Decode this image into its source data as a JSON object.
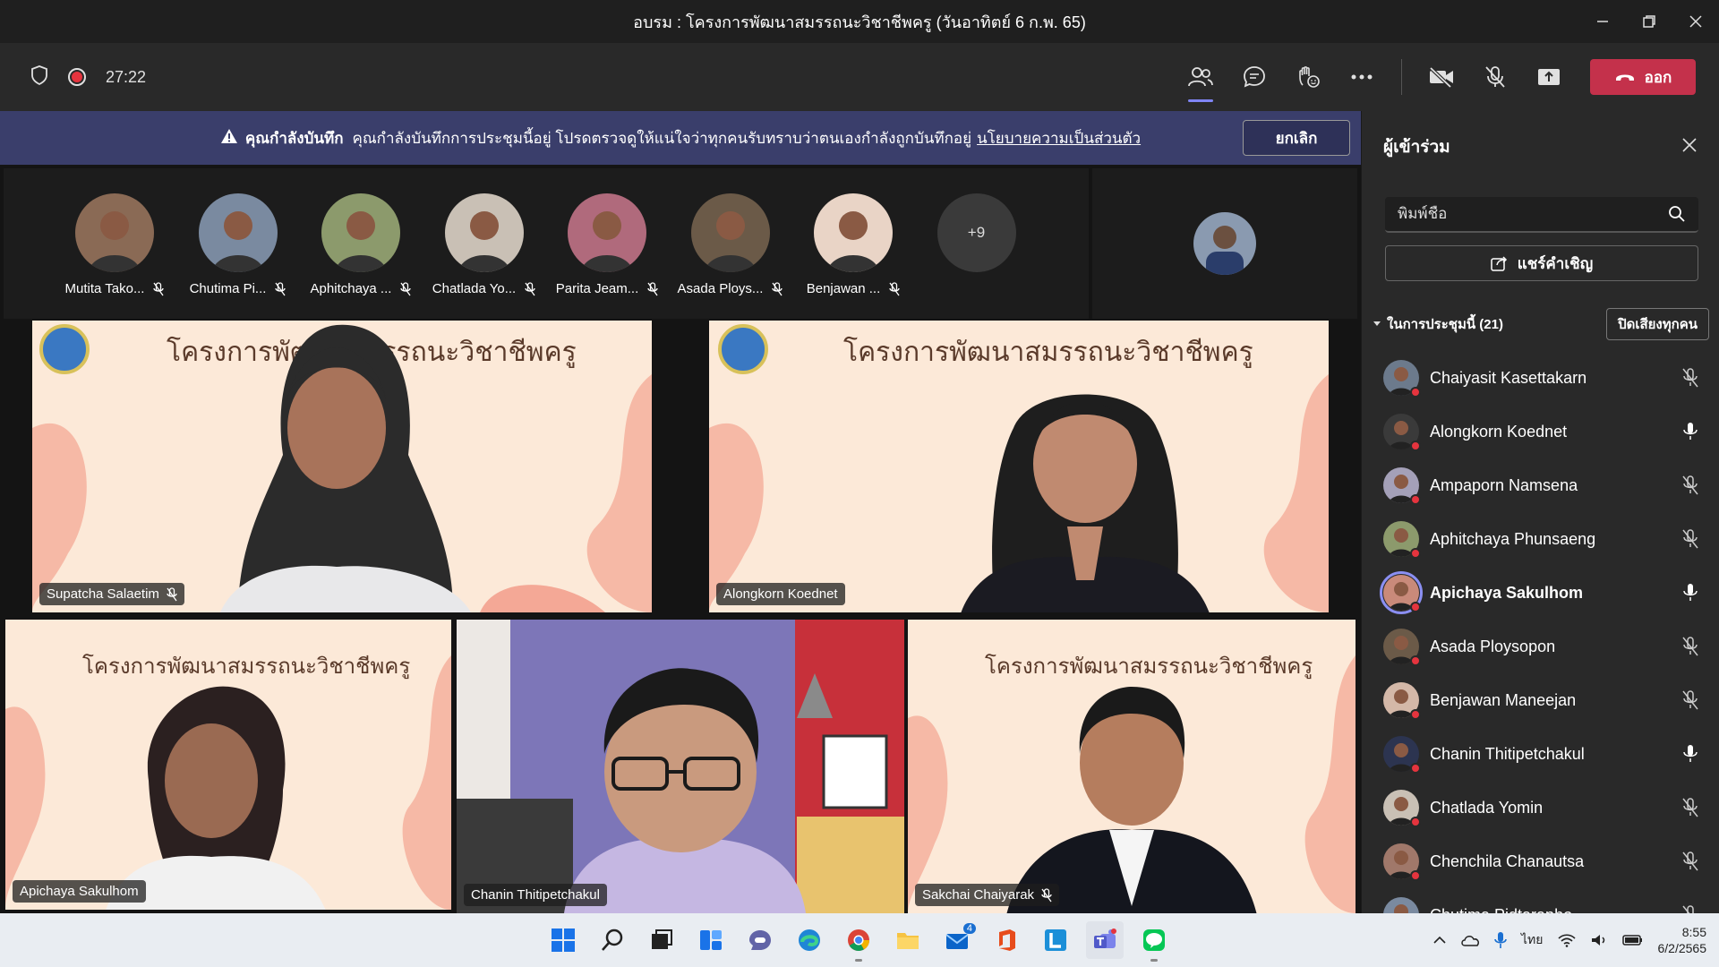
{
  "window": {
    "title": "อบรม : โครงการพัฒนาสมรรถนะวิชาชีพครู (วันอาทิตย์ 6 ก.พ. 65)"
  },
  "toolbar": {
    "timer": "27:22",
    "leave_label": "ออก"
  },
  "banner": {
    "title": "คุณกำลังบันทึก",
    "message": "คุณกำลังบันทึกการประชุมนี้อยู่ โปรดตรวจดูให้แน่ใจว่าทุกคนรับทราบว่าตนเองกำลังถูกบันทึกอยู่",
    "link": "นโยบายความเป็นส่วนตัว",
    "cancel_label": "ยกเลิก"
  },
  "strip": {
    "avatars": [
      {
        "name": "Mutita Tako...",
        "color": "#8a6a55"
      },
      {
        "name": "Chutima Pi...",
        "color": "#7a8aa0"
      },
      {
        "name": "Aphitchaya ...",
        "color": "#8c9a6c"
      },
      {
        "name": "Chatlada Yo...",
        "color": "#c9c0b5"
      },
      {
        "name": "Parita Jeam...",
        "color": "#b06a7c"
      },
      {
        "name": "Asada Ploys...",
        "color": "#6b5a48"
      },
      {
        "name": "Benjawan ...",
        "color": "#e9d4c6"
      }
    ],
    "more": "+9"
  },
  "tiles": {
    "t1": {
      "name": "Supatcha Salaetim"
    },
    "t2": {
      "name": "Alongkorn Koednet"
    },
    "t3": {
      "name": "Apichaya Sakulhom"
    },
    "t4": {
      "name": "Chanin Thitipetchakul"
    },
    "t5": {
      "name": "Sakchai Chaiyarak"
    }
  },
  "slide": {
    "title": "โครงการพัฒนาสมรรถนะวิชาชีพครู"
  },
  "panel": {
    "title": "ผู้เข้าร่วม",
    "search_placeholder": "พิมพ์ชื่อ",
    "invite_label": "แชร์คำเชิญ",
    "in_meeting_label": "ในการประชุมนี้ (21)",
    "mute_all_label": "ปิดเสียงทุกคน",
    "participants": [
      {
        "name": "Chaiyasit Kasettakarn",
        "muted": true,
        "color": "#6c7a8c"
      },
      {
        "name": "Alongkorn Koednet",
        "muted": false,
        "color": "#3a3a3a"
      },
      {
        "name": "Ampaporn Namsena",
        "muted": true,
        "color": "#a4a0b8"
      },
      {
        "name": "Aphitchaya Phunsaeng",
        "muted": true,
        "color": "#8c9a6c"
      },
      {
        "name": "Apichaya Sakulhom",
        "muted": false,
        "color": "#c98a7a"
      },
      {
        "name": "Asada Ploysopon",
        "muted": true,
        "color": "#6b5a48"
      },
      {
        "name": "Benjawan Maneejan",
        "muted": true,
        "color": "#d4b8a8"
      },
      {
        "name": "Chanin Thitipetchakul",
        "muted": false,
        "color": "#2c3450"
      },
      {
        "name": "Chatlada Yomin",
        "muted": true,
        "color": "#c9c0b5"
      },
      {
        "name": "Chenchila Chanautsa",
        "muted": true,
        "color": "#a0786a"
      },
      {
        "name": "Chutima Pidtarapho",
        "muted": true,
        "color": "#7a8aa0"
      }
    ]
  },
  "taskbar": {
    "time": "8:55",
    "date": "6/2/2565",
    "lang": "ไทย",
    "mail_badge": "4"
  },
  "colors": {
    "accent": "#8b8ff2",
    "leave": "#c4314b",
    "banner": "#3a3e6b"
  }
}
